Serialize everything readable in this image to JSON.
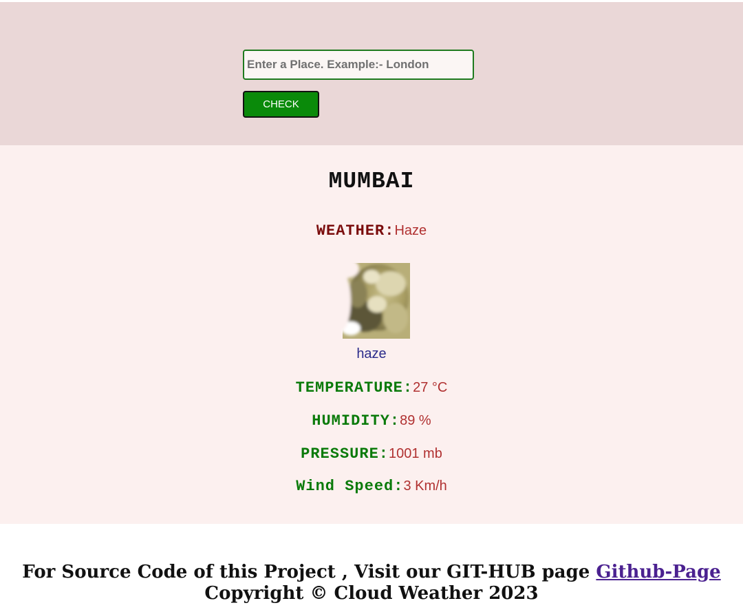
{
  "search": {
    "placeholder": "Enter a Place. Example:- London",
    "button_label": "CHECK"
  },
  "result": {
    "city": "MUMBAI",
    "weather_label": "WEATHER:",
    "weather_value": "Haze",
    "icon_caption": "haze",
    "temperature_label": "TEMPERATURE:",
    "temperature_value": "27 °C",
    "humidity_label": "HUMIDITY:",
    "humidity_value": "89 %",
    "pressure_label": "PRESSURE:",
    "pressure_value": "1001 mb",
    "wind_label": "Wind Speed:",
    "wind_value": "3 Km/h"
  },
  "footer": {
    "source_text": "For Source Code of this Project , Visit our GIT-HUB page ",
    "link_label": "Github-Page",
    "copyright": "Copyright © Cloud Weather 2023"
  },
  "colors": {
    "search_bg": "#ead7d7",
    "result_bg": "#fcf0ef",
    "button_bg": "#0a8a0a",
    "value_text": "#b03030",
    "link": "#4b2190"
  }
}
